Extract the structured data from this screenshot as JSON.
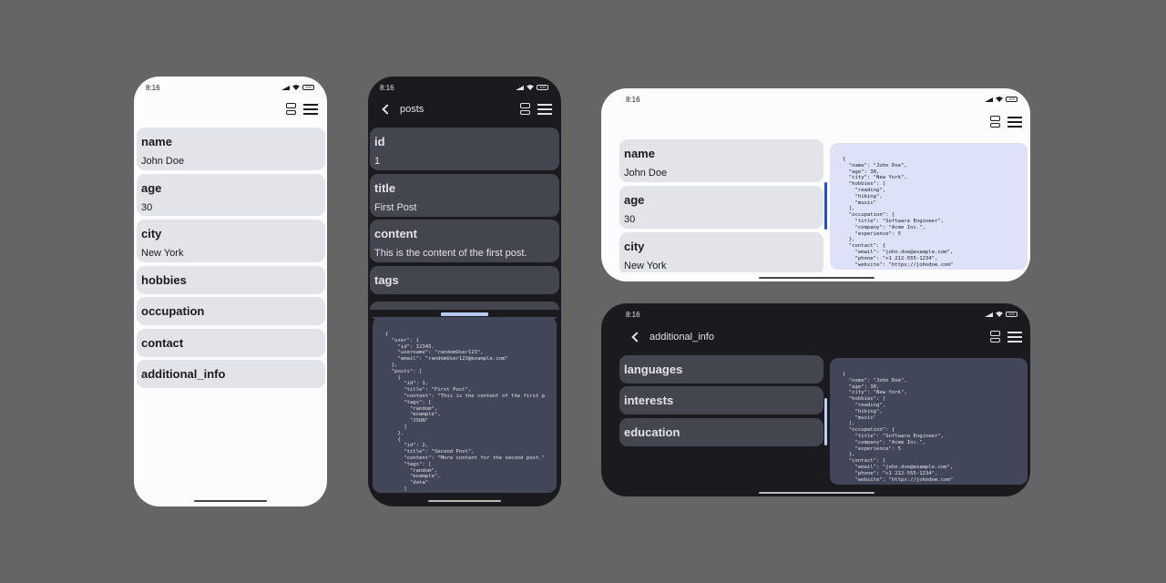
{
  "status": {
    "time": "8:16",
    "battery": "100"
  },
  "colors": {
    "accent_light": "#2050d0",
    "accent_dark": "#c0d0f4",
    "card_light": "#e3e3ea",
    "card_dark": "#44464f"
  },
  "phone1": {
    "items": [
      {
        "key": "name",
        "value": "John Doe"
      },
      {
        "key": "age",
        "value": "30"
      },
      {
        "key": "city",
        "value": "New York"
      },
      {
        "key": "hobbies"
      },
      {
        "key": "occupation"
      },
      {
        "key": "contact"
      },
      {
        "key": "additional_info"
      }
    ]
  },
  "phone2": {
    "title": "posts",
    "items": [
      {
        "key": "id",
        "value": "1"
      },
      {
        "key": "title",
        "value": "First Post"
      },
      {
        "key": "content",
        "value": "This is the content of the first post."
      },
      {
        "key": "tags"
      }
    ],
    "code": "{\n  \"user\": {\n    \"id\": 12345,\n    \"username\": \"randomUser123\",\n    \"email\": \"randomUser123@example.com\"\n  },\n  \"posts\": [\n    {\n      \"id\": 1,\n      \"title\": \"First Post\",\n      \"content\": \"This is the content of the first p\n      \"tags\": [\n        \"random\",\n        \"example\",\n        \"JSON\"\n      ]\n    },\n    {\n      \"id\": 2,\n      \"title\": \"Second Post\",\n      \"content\": \"More content for the second post.\"\n      \"tags\": [\n        \"random\",\n        \"example\",\n        \"data\"\n      ]"
  },
  "phone3": {
    "items": [
      {
        "key": "name",
        "value": "John Doe"
      },
      {
        "key": "age",
        "value": "30"
      },
      {
        "key": "city",
        "value": "New York"
      }
    ],
    "code": "{\n  \"name\": \"John Doe\",\n  \"age\": 30,\n  \"city\": \"New York\",\n  \"hobbies\": [\n    \"reading\",\n    \"hiking\",\n    \"music\"\n  ],\n  \"occupation\": {\n    \"title\": \"Software Engineer\",\n    \"company\": \"Acme Inc.\",\n    \"experience\": 5\n  },\n  \"contact\": {\n    \"email\": \"john.doe@example.com\",\n    \"phone\": \"+1 212-555-1234\",\n    \"website\": \"https://johndoe.com\""
  },
  "phone4": {
    "title": "additional_info",
    "items": [
      {
        "key": "languages"
      },
      {
        "key": "interests"
      },
      {
        "key": "education"
      }
    ],
    "code": "{\n  \"name\": \"John Doe\",\n  \"age\": 30,\n  \"city\": \"New York\",\n  \"hobbies\": [\n    \"reading\",\n    \"hiking\",\n    \"music\"\n  ],\n  \"occupation\": {\n    \"title\": \"Software Engineer\",\n    \"company\": \"Acme Inc.\",\n    \"experience\": 5\n  },\n  \"contact\": {\n    \"email\": \"john.doe@example.com\",\n    \"phone\": \"+1 212-555-1234\",\n    \"website\": \"https://johndoe.com\""
  }
}
